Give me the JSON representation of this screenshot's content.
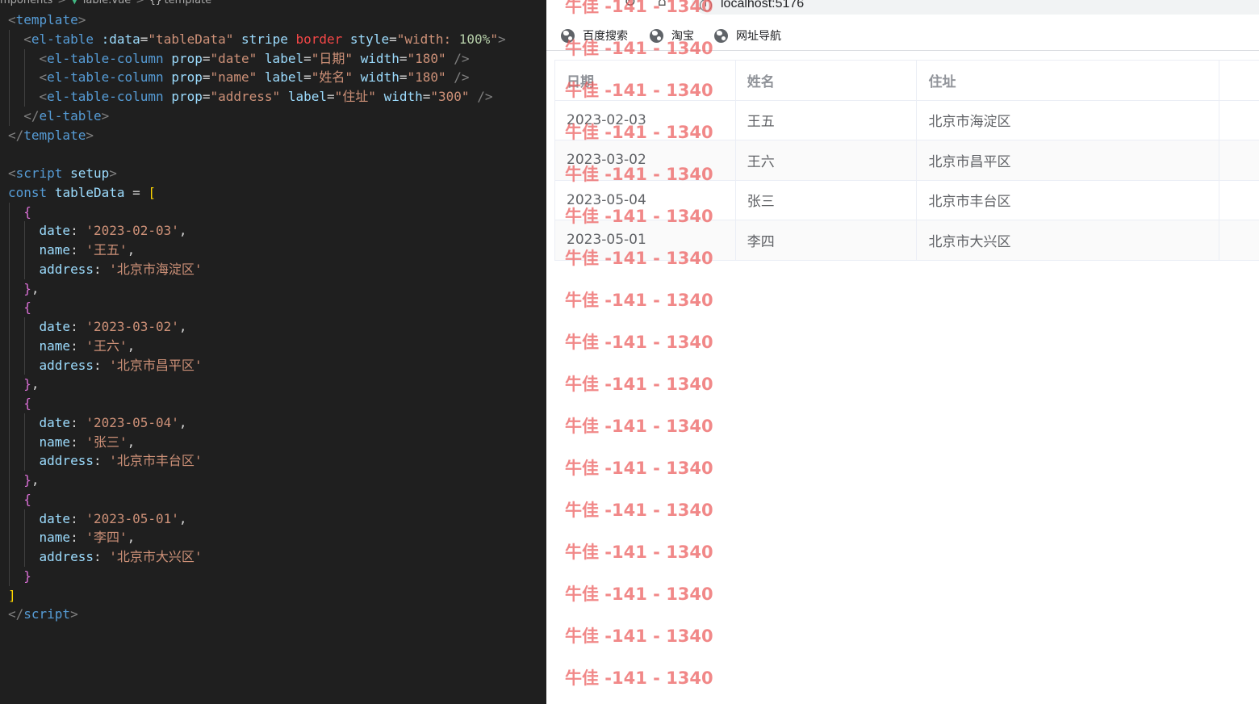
{
  "editor": {
    "breadcrumb": [
      "mponents",
      "Table.vue",
      "template"
    ],
    "lines": [
      [
        [
          "tk-punc",
          "<"
        ],
        [
          "tk-tag",
          "template"
        ],
        [
          "tk-punc",
          ">"
        ]
      ],
      [
        [
          "tk-eq",
          "  "
        ],
        [
          "tk-punc",
          "<"
        ],
        [
          "tk-tag",
          "el-table"
        ],
        [
          "tk-eq",
          " "
        ],
        [
          "tk-attr",
          ":data"
        ],
        [
          "tk-eq",
          "="
        ],
        [
          "tk-str",
          "\"tableData\""
        ],
        [
          "tk-eq",
          " "
        ],
        [
          "tk-attr",
          "stripe"
        ],
        [
          "tk-eq",
          " "
        ],
        [
          "tk-red",
          "border"
        ],
        [
          "tk-eq",
          " "
        ],
        [
          "tk-attr",
          "style"
        ],
        [
          "tk-eq",
          "="
        ],
        [
          "tk-str",
          "\"width: "
        ],
        [
          "tk-num",
          "100%"
        ],
        [
          "tk-str",
          "\""
        ],
        [
          "tk-punc",
          ">"
        ]
      ],
      [
        [
          "tk-eq",
          "    "
        ],
        [
          "tk-punc",
          "<"
        ],
        [
          "tk-tag",
          "el-table-column"
        ],
        [
          "tk-eq",
          " "
        ],
        [
          "tk-attr",
          "prop"
        ],
        [
          "tk-eq",
          "="
        ],
        [
          "tk-str",
          "\"date\""
        ],
        [
          "tk-eq",
          " "
        ],
        [
          "tk-attr",
          "label"
        ],
        [
          "tk-eq",
          "="
        ],
        [
          "tk-str",
          "\"日期\""
        ],
        [
          "tk-eq",
          " "
        ],
        [
          "tk-attr",
          "width"
        ],
        [
          "tk-eq",
          "="
        ],
        [
          "tk-str",
          "\"180\""
        ],
        [
          "tk-eq",
          " "
        ],
        [
          "tk-punc",
          "/>"
        ]
      ],
      [
        [
          "tk-eq",
          "    "
        ],
        [
          "tk-punc",
          "<"
        ],
        [
          "tk-tag",
          "el-table-column"
        ],
        [
          "tk-eq",
          " "
        ],
        [
          "tk-attr",
          "prop"
        ],
        [
          "tk-eq",
          "="
        ],
        [
          "tk-str",
          "\"name\""
        ],
        [
          "tk-eq",
          " "
        ],
        [
          "tk-attr",
          "label"
        ],
        [
          "tk-eq",
          "="
        ],
        [
          "tk-str",
          "\"姓名\""
        ],
        [
          "tk-eq",
          " "
        ],
        [
          "tk-attr",
          "width"
        ],
        [
          "tk-eq",
          "="
        ],
        [
          "tk-str",
          "\"180\""
        ],
        [
          "tk-eq",
          " "
        ],
        [
          "tk-punc",
          "/>"
        ]
      ],
      [
        [
          "tk-eq",
          "    "
        ],
        [
          "tk-punc",
          "<"
        ],
        [
          "tk-tag",
          "el-table-column"
        ],
        [
          "tk-eq",
          " "
        ],
        [
          "tk-attr",
          "prop"
        ],
        [
          "tk-eq",
          "="
        ],
        [
          "tk-str",
          "\"address\""
        ],
        [
          "tk-eq",
          " "
        ],
        [
          "tk-attr",
          "label"
        ],
        [
          "tk-eq",
          "="
        ],
        [
          "tk-str",
          "\"住址\""
        ],
        [
          "tk-eq",
          " "
        ],
        [
          "tk-attr",
          "width"
        ],
        [
          "tk-eq",
          "="
        ],
        [
          "tk-str",
          "\"300\""
        ],
        [
          "tk-eq",
          " "
        ],
        [
          "tk-punc",
          "/>"
        ]
      ],
      [
        [
          "tk-eq",
          "  "
        ],
        [
          "tk-punc",
          "</"
        ],
        [
          "tk-tag",
          "el-table"
        ],
        [
          "tk-punc",
          ">"
        ]
      ],
      [
        [
          "tk-punc",
          "</"
        ],
        [
          "tk-tag",
          "template"
        ],
        [
          "tk-punc",
          ">"
        ]
      ],
      [],
      [
        [
          "tk-punc",
          "<"
        ],
        [
          "tk-tag",
          "script"
        ],
        [
          "tk-eq",
          " "
        ],
        [
          "tk-attr",
          "setup"
        ],
        [
          "tk-punc",
          ">"
        ]
      ],
      [
        [
          "tk-key",
          "const"
        ],
        [
          "tk-eq",
          " "
        ],
        [
          "tk-var",
          "tableData"
        ],
        [
          "tk-eq",
          " = "
        ],
        [
          "tk-br1",
          "["
        ]
      ],
      [
        [
          "tk-eq",
          "  "
        ],
        [
          "tk-br2",
          "{"
        ]
      ],
      [
        [
          "tk-eq",
          "    "
        ],
        [
          "tk-prop",
          "date"
        ],
        [
          "tk-eq",
          ": "
        ],
        [
          "tk-str",
          "'2023-02-03'"
        ],
        [
          "tk-eq",
          ","
        ]
      ],
      [
        [
          "tk-eq",
          "    "
        ],
        [
          "tk-prop",
          "name"
        ],
        [
          "tk-eq",
          ": "
        ],
        [
          "tk-str",
          "'王五'"
        ],
        [
          "tk-eq",
          ","
        ]
      ],
      [
        [
          "tk-eq",
          "    "
        ],
        [
          "tk-prop",
          "address"
        ],
        [
          "tk-eq",
          ": "
        ],
        [
          "tk-str",
          "'北京市海淀区'"
        ]
      ],
      [
        [
          "tk-eq",
          "  "
        ],
        [
          "tk-br2",
          "}"
        ],
        [
          "tk-eq",
          ","
        ]
      ],
      [
        [
          "tk-eq",
          "  "
        ],
        [
          "tk-br2",
          "{"
        ]
      ],
      [
        [
          "tk-eq",
          "    "
        ],
        [
          "tk-prop",
          "date"
        ],
        [
          "tk-eq",
          ": "
        ],
        [
          "tk-str",
          "'2023-03-02'"
        ],
        [
          "tk-eq",
          ","
        ]
      ],
      [
        [
          "tk-eq",
          "    "
        ],
        [
          "tk-prop",
          "name"
        ],
        [
          "tk-eq",
          ": "
        ],
        [
          "tk-str",
          "'王六'"
        ],
        [
          "tk-eq",
          ","
        ]
      ],
      [
        [
          "tk-eq",
          "    "
        ],
        [
          "tk-prop",
          "address"
        ],
        [
          "tk-eq",
          ": "
        ],
        [
          "tk-str",
          "'北京市昌平区'"
        ]
      ],
      [
        [
          "tk-eq",
          "  "
        ],
        [
          "tk-br2",
          "}"
        ],
        [
          "tk-eq",
          ","
        ]
      ],
      [
        [
          "tk-eq",
          "  "
        ],
        [
          "tk-br2",
          "{"
        ]
      ],
      [
        [
          "tk-eq",
          "    "
        ],
        [
          "tk-prop",
          "date"
        ],
        [
          "tk-eq",
          ": "
        ],
        [
          "tk-str",
          "'2023-05-04'"
        ],
        [
          "tk-eq",
          ","
        ]
      ],
      [
        [
          "tk-eq",
          "    "
        ],
        [
          "tk-prop",
          "name"
        ],
        [
          "tk-eq",
          ": "
        ],
        [
          "tk-str",
          "'张三'"
        ],
        [
          "tk-eq",
          ","
        ]
      ],
      [
        [
          "tk-eq",
          "    "
        ],
        [
          "tk-prop",
          "address"
        ],
        [
          "tk-eq",
          ": "
        ],
        [
          "tk-str",
          "'北京市丰台区'"
        ]
      ],
      [
        [
          "tk-eq",
          "  "
        ],
        [
          "tk-br2",
          "}"
        ],
        [
          "tk-eq",
          ","
        ]
      ],
      [
        [
          "tk-eq",
          "  "
        ],
        [
          "tk-br2",
          "{"
        ]
      ],
      [
        [
          "tk-eq",
          "    "
        ],
        [
          "tk-prop",
          "date"
        ],
        [
          "tk-eq",
          ": "
        ],
        [
          "tk-str",
          "'2023-05-01'"
        ],
        [
          "tk-eq",
          ","
        ]
      ],
      [
        [
          "tk-eq",
          "    "
        ],
        [
          "tk-prop",
          "name"
        ],
        [
          "tk-eq",
          ": "
        ],
        [
          "tk-str",
          "'李四'"
        ],
        [
          "tk-eq",
          ","
        ]
      ],
      [
        [
          "tk-eq",
          "    "
        ],
        [
          "tk-prop",
          "address"
        ],
        [
          "tk-eq",
          ": "
        ],
        [
          "tk-str",
          "'北京市大兴区'"
        ]
      ],
      [
        [
          "tk-eq",
          "  "
        ],
        [
          "tk-br2",
          "}"
        ]
      ],
      [
        [
          "tk-br1",
          "]"
        ]
      ],
      [
        [
          "tk-punc",
          "</"
        ],
        [
          "tk-tag",
          "script"
        ],
        [
          "tk-punc",
          ">"
        ]
      ]
    ]
  },
  "browser": {
    "url": "localhost:5176",
    "bookmarks": [
      "百度搜索",
      "淘宝",
      "网址导航"
    ]
  },
  "table": {
    "headers": [
      "日期",
      "姓名",
      "住址"
    ],
    "rows": [
      [
        "2023-02-03",
        "王五",
        "北京市海淀区"
      ],
      [
        "2023-03-02",
        "王六",
        "北京市昌平区"
      ],
      [
        "2023-05-04",
        "张三",
        "北京市丰台区"
      ],
      [
        "2023-05-01",
        "李四",
        "北京市大兴区"
      ]
    ]
  },
  "watermark": {
    "text": "牛佳 -141 - 1340",
    "count": 17
  }
}
